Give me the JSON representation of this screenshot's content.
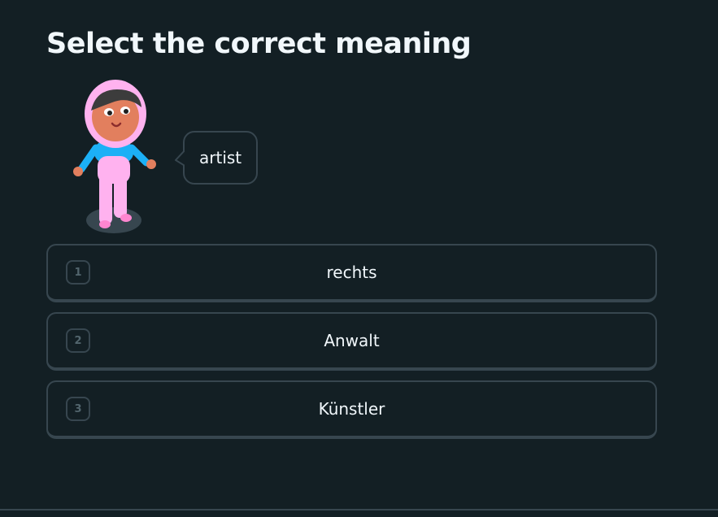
{
  "challenge": {
    "title": "Select the correct meaning",
    "prompt_word": "artist"
  },
  "options": [
    {
      "key": "1",
      "label": "rechts"
    },
    {
      "key": "2",
      "label": "Anwalt"
    },
    {
      "key": "3",
      "label": "Künstler"
    }
  ],
  "colors": {
    "background": "#131f24",
    "border": "#37464f",
    "text": "#f1f7fb",
    "key_text": "#52656d",
    "character_hijab": "#ffb2ef",
    "character_shirt": "#1cb0f6",
    "character_skin": "#e27f5e"
  }
}
